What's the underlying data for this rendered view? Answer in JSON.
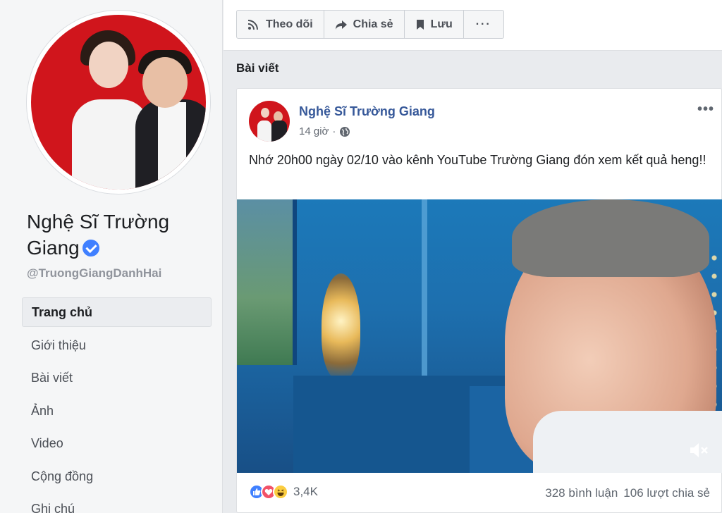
{
  "sidebar": {
    "page_name": "Nghệ Sĩ Trường Giang",
    "handle": "@TruongGiangDanhHai",
    "nav": [
      {
        "label": "Trang chủ",
        "active": true
      },
      {
        "label": "Giới thiệu"
      },
      {
        "label": "Bài viết"
      },
      {
        "label": "Ảnh"
      },
      {
        "label": "Video"
      },
      {
        "label": "Cộng đồng"
      },
      {
        "label": "Ghi chú"
      }
    ]
  },
  "actions": {
    "follow": {
      "label": "Theo dõi",
      "icon": "rss-icon"
    },
    "share": {
      "label": "Chia sẻ",
      "icon": "share-arrow-icon"
    },
    "save": {
      "label": "Lưu",
      "icon": "bookmark-icon"
    },
    "more": "···"
  },
  "section": {
    "title": "Bài viết"
  },
  "post": {
    "author": "Nghệ Sĩ Trường Giang",
    "time": "14 giờ",
    "separator": "·",
    "privacy_icon": "globe-icon",
    "text": "Nhớ 20h00 ngày 02/10 vào kênh YouTube Trường Giang đón xem kết quả heng!!",
    "menu": "•••",
    "video": {
      "muted": true,
      "icon": "volume-muted-icon"
    },
    "reactions": {
      "types": [
        "like",
        "love",
        "haha"
      ],
      "count": "3,4K"
    },
    "comments": "328 bình luận",
    "shares": "106 lượt chia sẻ"
  },
  "colors": {
    "link": "#365899",
    "like": "#4080ff",
    "love": "#f25268",
    "haha": "#fbcd40",
    "verified": "#4080ff"
  }
}
